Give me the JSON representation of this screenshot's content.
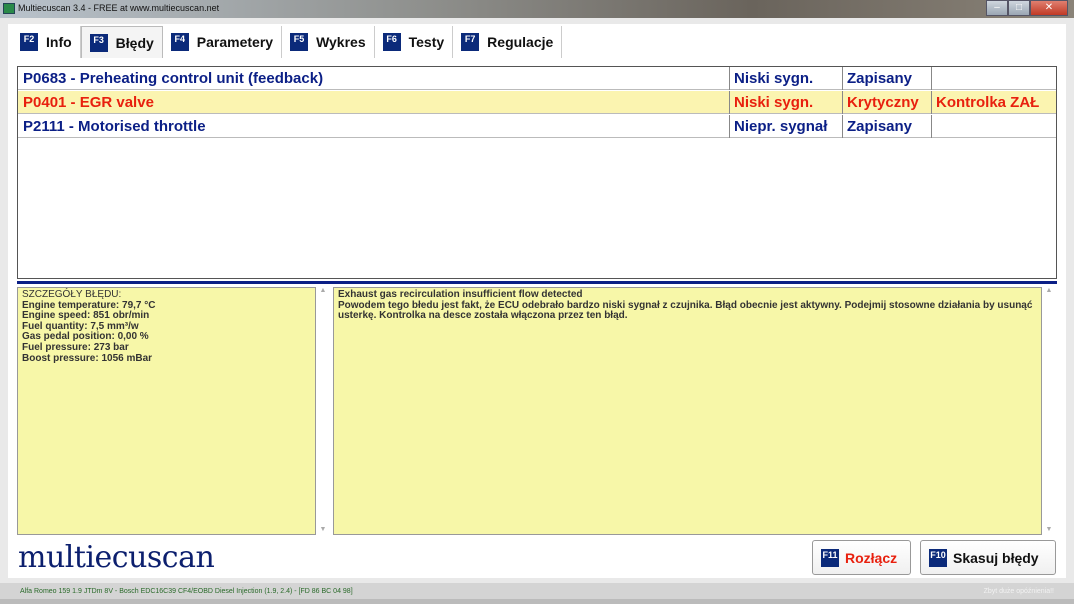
{
  "window": {
    "title": "Multiecuscan 3.4 - FREE at www.multiecuscan.net"
  },
  "tabs": [
    {
      "key": "F2",
      "label": "Info"
    },
    {
      "key": "F3",
      "label": "Błędy"
    },
    {
      "key": "F4",
      "label": "Parametery"
    },
    {
      "key": "F5",
      "label": "Wykres"
    },
    {
      "key": "F6",
      "label": "Testy"
    },
    {
      "key": "F7",
      "label": "Regulacje"
    }
  ],
  "faults": [
    {
      "code": "P0683 - Preheating control unit (feedback)",
      "signal": "Niski sygn.",
      "status": "Zapisany",
      "lamp": ""
    },
    {
      "code": "P0401 - EGR valve",
      "signal": "Niski sygn.",
      "status": "Krytyczny",
      "lamp": "Kontrolka ZAŁ"
    },
    {
      "code": "P2111 - Motorised throttle",
      "signal": "Niepr. sygnał",
      "status": "Zapisany",
      "lamp": ""
    }
  ],
  "details": {
    "title": "SZCZEGÓŁY BŁĘDU:",
    "lines": [
      "Engine temperature: 79,7 °C",
      "Engine speed: 851 obr/min",
      "Fuel quantity: 7,5 mm³/w",
      "Gas pedal position: 0,00 %",
      "Fuel pressure: 273 bar",
      "Boost pressure: 1056 mBar"
    ]
  },
  "description": {
    "title": "Exhaust gas recirculation insufficient flow detected",
    "text": "Powodem tego błedu jest fakt, że ECU odebrało bardzo niski sygnał z czujnika. Błąd obecnie jest aktywny. Podejmij stosowne działania by usunąć usterkę. Kontrolka na desce została włączona przez ten błąd."
  },
  "logo": "multiecuscan",
  "buttons": {
    "disconnect": {
      "key": "F11",
      "label": "Rozłącz"
    },
    "clear": {
      "key": "F10",
      "label": "Skasuj błędy"
    }
  },
  "status": {
    "vehicle": "Alfa Romeo 159 1.9 JTDm 8V - Bosch EDC16C39 CF4/EOBD Diesel Injection (1.9, 2.4) - [FD 86 BC 04 98]",
    "warning": "Zbyt duże opóźnienia!!"
  },
  "colors": {
    "accent": "#0b1f86",
    "error": "#e8200e",
    "highlight": "#fbf4b0",
    "panel": "#f7f7a8"
  }
}
